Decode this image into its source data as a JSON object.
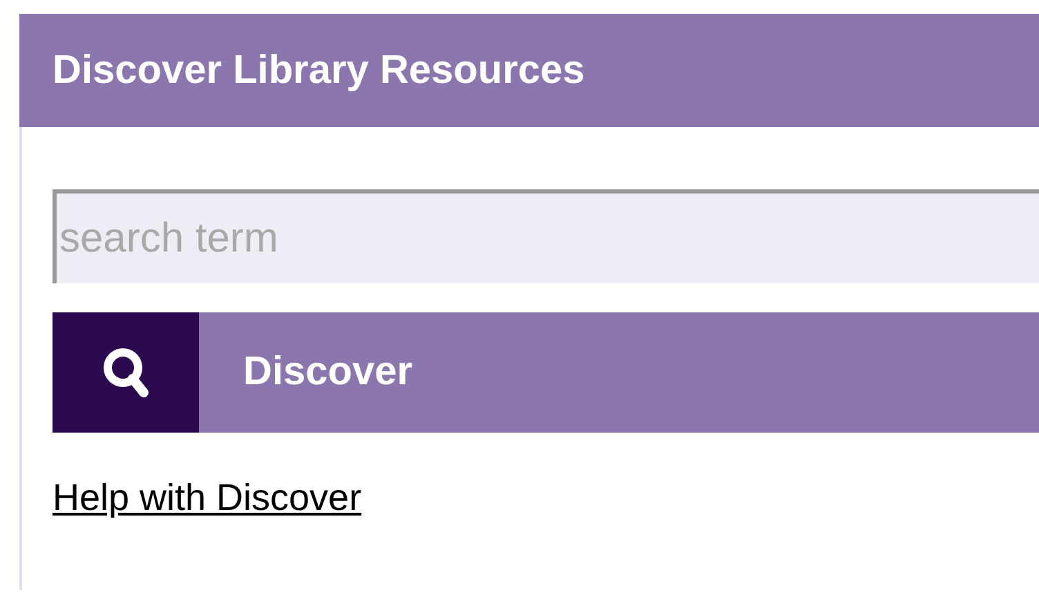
{
  "panel": {
    "title": "Discover Library Resources"
  },
  "search": {
    "placeholder": "search term"
  },
  "button": {
    "label": "Discover"
  },
  "help_link": {
    "label": "Help with Discover"
  }
}
